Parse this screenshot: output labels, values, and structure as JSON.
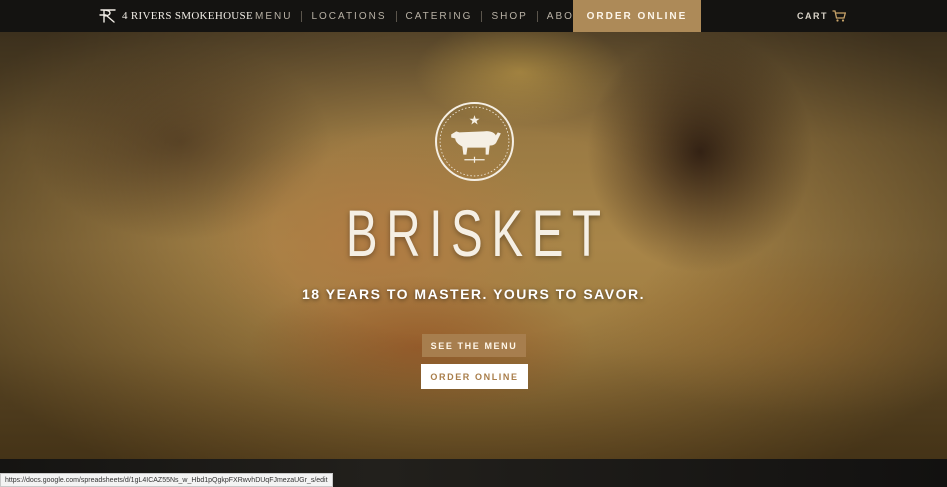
{
  "nav": {
    "brand": "4 RIVERS SMOKEHOUSE",
    "links": [
      "MENU",
      "LOCATIONS",
      "CATERING",
      "SHOP",
      "ABOUT"
    ],
    "order_online": "ORDER ONLINE",
    "cart": "CART"
  },
  "hero": {
    "title": "BRISKET",
    "subtitle": "18 YEARS TO MASTER. YOURS TO SAVOR.",
    "emblem_icon": "steer-badge-icon",
    "buttons": {
      "see_menu": "SEE THE MENU",
      "order_online": "ORDER ONLINE"
    }
  },
  "status_bar": {
    "url": "https://docs.google.com/spreadsheets/d/1gL4ICAZ55Ns_w_Hbd1pQgkpFXRwvhDUqFJmezaUGr_s/edit"
  },
  "colors": {
    "nav_background": "#141311",
    "accent_gold": "#ad8a58",
    "button_brown": "#a77e4e",
    "text_light": "#f5efe4"
  }
}
